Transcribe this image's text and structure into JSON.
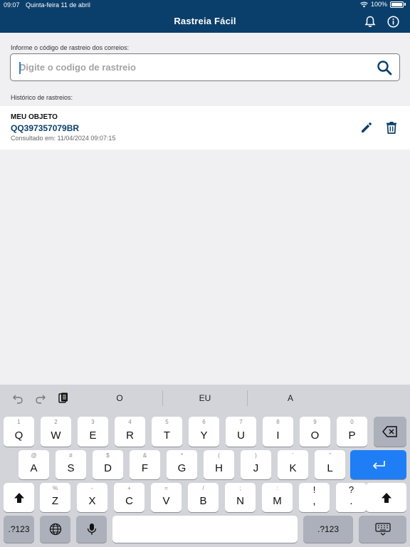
{
  "status": {
    "time": "09:07",
    "date": "Quinta-feira 11 de abril",
    "battery": "100%"
  },
  "header": {
    "title": "Rastreia Fácil"
  },
  "search": {
    "prompt": "Informe o código de rastreio dos correios:",
    "placeholder": "Digite o codigo de rastreio",
    "value": ""
  },
  "history": {
    "label": "Histórico de rastreios:",
    "items": [
      {
        "name": "MEU OBJETO",
        "code": "QQ397357079BR",
        "consulted": "Consultado em: 11/04/2024 09:07:15"
      }
    ]
  },
  "keyboard": {
    "suggestions": [
      "O",
      "EU",
      "A"
    ],
    "row1": [
      {
        "k": "Q",
        "s": "1"
      },
      {
        "k": "W",
        "s": "2"
      },
      {
        "k": "E",
        "s": "3"
      },
      {
        "k": "R",
        "s": "4"
      },
      {
        "k": "T",
        "s": "5"
      },
      {
        "k": "Y",
        "s": "6"
      },
      {
        "k": "U",
        "s": "7"
      },
      {
        "k": "I",
        "s": "8"
      },
      {
        "k": "O",
        "s": "9"
      },
      {
        "k": "P",
        "s": "0"
      }
    ],
    "row2": [
      {
        "k": "A",
        "s": "@"
      },
      {
        "k": "S",
        "s": "#"
      },
      {
        "k": "D",
        "s": "$"
      },
      {
        "k": "F",
        "s": "&"
      },
      {
        "k": "G",
        "s": "*"
      },
      {
        "k": "H",
        "s": "("
      },
      {
        "k": "J",
        "s": ")"
      },
      {
        "k": "K",
        "s": "’"
      },
      {
        "k": "L",
        "s": "\""
      }
    ],
    "row3": [
      {
        "k": "Z",
        "s": "%"
      },
      {
        "k": "X",
        "s": "-"
      },
      {
        "k": "C",
        "s": "+"
      },
      {
        "k": "V",
        "s": "="
      },
      {
        "k": "B",
        "s": "/"
      },
      {
        "k": "N",
        "s": ";"
      },
      {
        "k": "M",
        "s": ":"
      },
      {
        "k": ",",
        "s": "!"
      },
      {
        "k": ".",
        "s": "?"
      }
    ],
    "numbers_label": ".?123",
    "accent": "#1f7ef5"
  },
  "colors": {
    "header": "#0b3f6b",
    "accent": "#0b3f6b"
  }
}
